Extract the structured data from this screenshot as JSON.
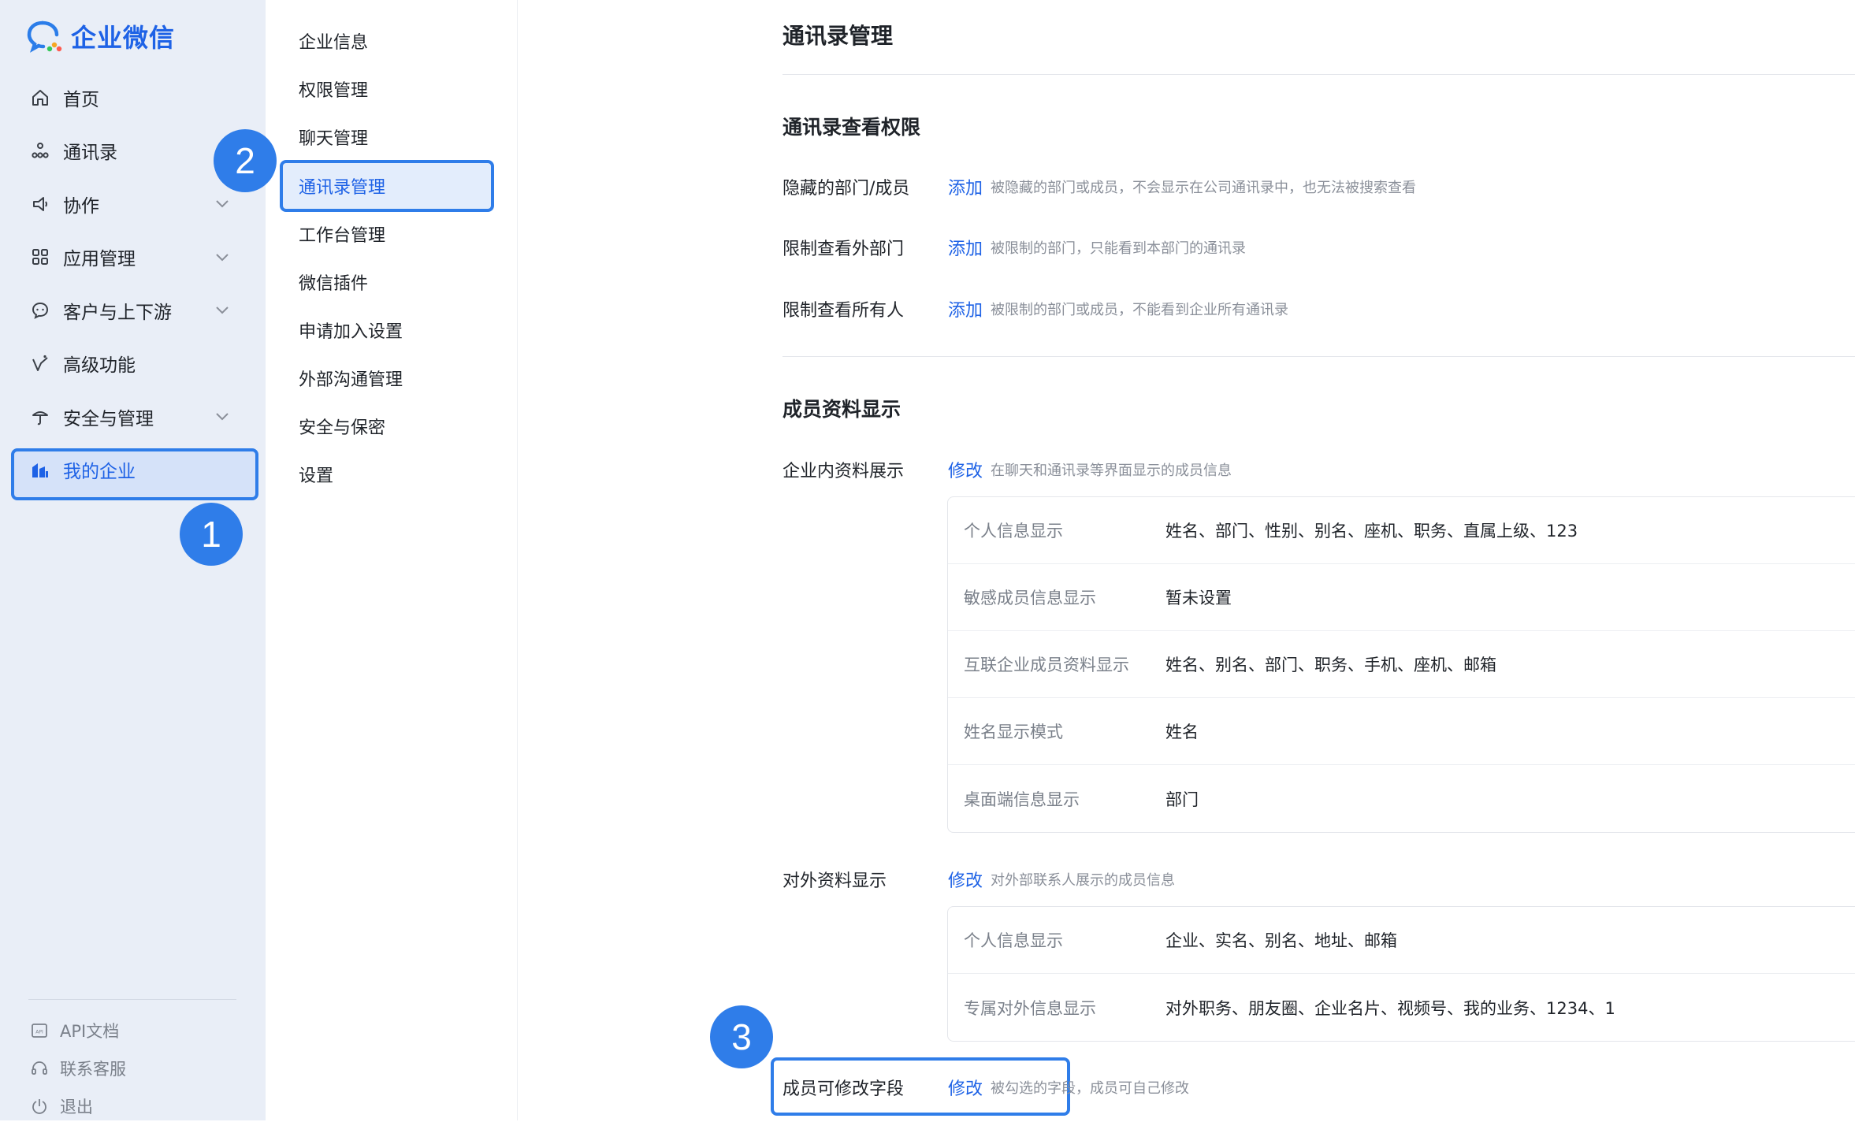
{
  "brand": {
    "name": "企业微信"
  },
  "nav": {
    "items": [
      {
        "label": "首页",
        "icon": "home-icon",
        "chevron": false
      },
      {
        "label": "通讯录",
        "icon": "contacts-icon",
        "chevron": false
      },
      {
        "label": "协作",
        "icon": "collab-icon",
        "chevron": true
      },
      {
        "label": "应用管理",
        "icon": "apps-icon",
        "chevron": true
      },
      {
        "label": "客户与上下游",
        "icon": "customer-icon",
        "chevron": true
      },
      {
        "label": "高级功能",
        "icon": "advanced-icon",
        "chevron": false
      },
      {
        "label": "安全与管理",
        "icon": "security-icon",
        "chevron": true
      },
      {
        "label": "我的企业",
        "icon": "my-company-icon",
        "chevron": false,
        "active": true
      }
    ],
    "footer": [
      {
        "label": "API文档",
        "icon": "api-doc-icon"
      },
      {
        "label": "联系客服",
        "icon": "support-icon"
      },
      {
        "label": "退出",
        "icon": "logout-icon"
      }
    ]
  },
  "submenu": {
    "items": [
      {
        "label": "企业信息"
      },
      {
        "label": "权限管理"
      },
      {
        "label": "聊天管理"
      },
      {
        "label": "通讯录管理",
        "active": true
      },
      {
        "label": "工作台管理"
      },
      {
        "label": "微信插件"
      },
      {
        "label": "申请加入设置"
      },
      {
        "label": "外部沟通管理"
      },
      {
        "label": "安全与保密"
      },
      {
        "label": "设置"
      }
    ]
  },
  "badges": {
    "one": "1",
    "two": "2",
    "three": "3"
  },
  "main": {
    "title": "通讯录管理",
    "view_perm": {
      "title": "通讯录查看权限",
      "rows": [
        {
          "label": "隐藏的部门/成员",
          "link": "添加",
          "desc": "被隐藏的部门或成员，不会显示在公司通讯录中，也无法被搜索查看"
        },
        {
          "label": "限制查看外部门",
          "link": "添加",
          "desc": "被限制的部门，只能看到本部门的通讯录"
        },
        {
          "label": "限制查看所有人",
          "link": "添加",
          "desc": "被限制的部门或成员，不能看到企业所有通讯录"
        }
      ]
    },
    "member_display": {
      "title": "成员资料显示",
      "internal": {
        "label": "企业内资料展示",
        "link": "修改",
        "desc": "在聊天和通讯录等界面显示的成员信息",
        "rows": [
          {
            "key": "个人信息显示",
            "value": "姓名、部门、性别、别名、座机、职务、直属上级、123"
          },
          {
            "key": "敏感成员信息显示",
            "value": "暂未设置"
          },
          {
            "key": "互联企业成员资料显示",
            "value": "姓名、别名、部门、职务、手机、座机、邮箱"
          },
          {
            "key": "姓名显示模式",
            "value": "姓名"
          },
          {
            "key": "桌面端信息显示",
            "value": "部门"
          }
        ]
      },
      "external": {
        "label": "对外资料显示",
        "link": "修改",
        "desc": "对外部联系人展示的成员信息",
        "rows": [
          {
            "key": "个人信息显示",
            "value": "企业、实名、别名、地址、邮箱"
          },
          {
            "key": "专属对外信息显示",
            "value": "对外职务、朋友圈、企业名片、视频号、我的业务、1234、1"
          }
        ]
      },
      "editable": {
        "label": "成员可修改字段",
        "link": "修改",
        "desc": "被勾选的字段，成员可自己修改"
      }
    }
  }
}
